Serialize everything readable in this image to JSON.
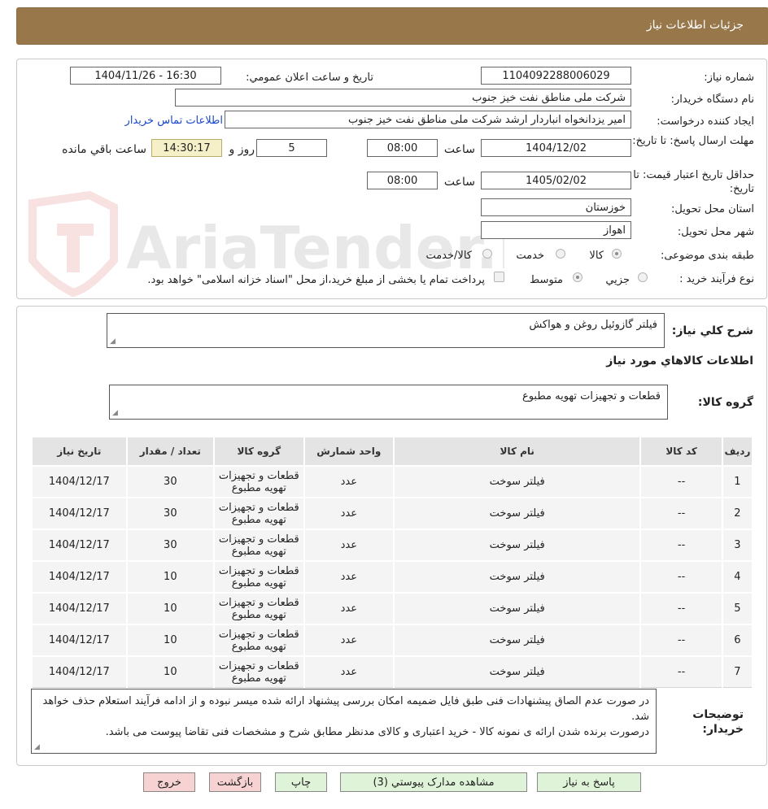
{
  "header": {
    "title": "جزئیات اطلاعات نیاز"
  },
  "watermark": {
    "text": "AriaTender.net"
  },
  "form": {
    "need_number_label": "شماره نیاز:",
    "need_number_value": "1104092288006029",
    "announce_label": "تاریخ و ساعت اعلان عمومي:",
    "announce_value": "1404/11/26 - 16:30",
    "buyer_org_label": "نام دستگاه خريدار:",
    "buyer_org_value": "شرکت ملی مناطق نفت خیز جنوب",
    "requester_label": "ايجاد کننده درخواست:",
    "requester_value": "امیر یزدانخواه انباردار ارشد شرکت ملی مناطق نفت خیز جنوب",
    "contact_link": "اطلاعات تماس خريدار",
    "deadline_label": "مهلت ارسال پاسخ: تا تاريخ:",
    "deadline_date": "1404/12/02",
    "time_label": "ساعت",
    "deadline_time": "08:00",
    "days_value": "5",
    "days_label": "روز و",
    "remaining_time": "14:30:17",
    "remaining_label": "ساعت باقي مانده",
    "validity_label": "حداقل تاريخ اعتبار قيمت: تا تاريخ:",
    "validity_date": "1405/02/02",
    "validity_time": "08:00",
    "province_label": "استان محل تحويل:",
    "province_value": "خوزستان",
    "city_label": "شهر محل تحويل:",
    "city_value": "اهواز",
    "category_label": "طبقه بندی موضوعی:",
    "category_options": [
      "کالا",
      "خدمت",
      "کالا/خدمت"
    ],
    "category_selected": "کالا",
    "process_label": "نوع فرآيند خريد :",
    "process_options": [
      "جزیي",
      "متوسط"
    ],
    "process_selected": "متوسط",
    "payment_note": "پرداخت تمام يا بخشی از مبلغ خريد،از محل \"اسناد خزانه اسلامی\" خواهد بود."
  },
  "details": {
    "general_desc_label": "شرح کلي نياز:",
    "general_desc_value": "فیلتر گازوئیل روغن و هواکش",
    "items_title": "اطلاعات کالاهاي مورد نياز",
    "group_label": "گروه کالا:",
    "group_value": "قطعات و تجهيزات تهويه مطبوع"
  },
  "table": {
    "headers": [
      "رديف",
      "کد کالا",
      "نام کالا",
      "واحد شمارش",
      "گروه کالا",
      "تعداد / مقدار",
      "تاريخ نياز"
    ],
    "rows": [
      [
        "1",
        "--",
        "فیلتر سوخت",
        "عدد",
        "قطعات و تجهيزات تهويه مطبوع",
        "30",
        "1404/12/17"
      ],
      [
        "2",
        "--",
        "فیلتر سوخت",
        "عدد",
        "قطعات و تجهيزات تهويه مطبوع",
        "30",
        "1404/12/17"
      ],
      [
        "3",
        "--",
        "فیلتر سوخت",
        "عدد",
        "قطعات و تجهيزات تهويه مطبوع",
        "30",
        "1404/12/17"
      ],
      [
        "4",
        "--",
        "فیلتر سوخت",
        "عدد",
        "قطعات و تجهيزات تهويه مطبوع",
        "10",
        "1404/12/17"
      ],
      [
        "5",
        "--",
        "فیلتر سوخت",
        "عدد",
        "قطعات و تجهيزات تهويه مطبوع",
        "10",
        "1404/12/17"
      ],
      [
        "6",
        "--",
        "فیلتر سوخت",
        "عدد",
        "قطعات و تجهيزات تهويه مطبوع",
        "10",
        "1404/12/17"
      ],
      [
        "7",
        "--",
        "فیلتر سوخت",
        "عدد",
        "قطعات و تجهيزات تهويه مطبوع",
        "10",
        "1404/12/17"
      ]
    ]
  },
  "notes": {
    "label": "توضيحات خريدار:",
    "line1": "در صورت عدم الصاق پیشنهادات فنی طبق فایل ضمیمه امکان بررسی پیشنهاد ارائه شده میسر نبوده و از ادامه فرآیند استعلام حذف خواهد شد.",
    "line2": "درصورت برنده شدن ارائه ی نمونه کالا - خرید اعتباری و کالای مدنظر مطابق شرح و مشخصات فنی تقاضا پیوست می باشد."
  },
  "buttons": {
    "reply": "پاسخ به نياز",
    "attachments": "مشاهده مدارک پيوستي (3)",
    "print": "چاپ",
    "back": "بازگشت",
    "exit": "خروج"
  }
}
